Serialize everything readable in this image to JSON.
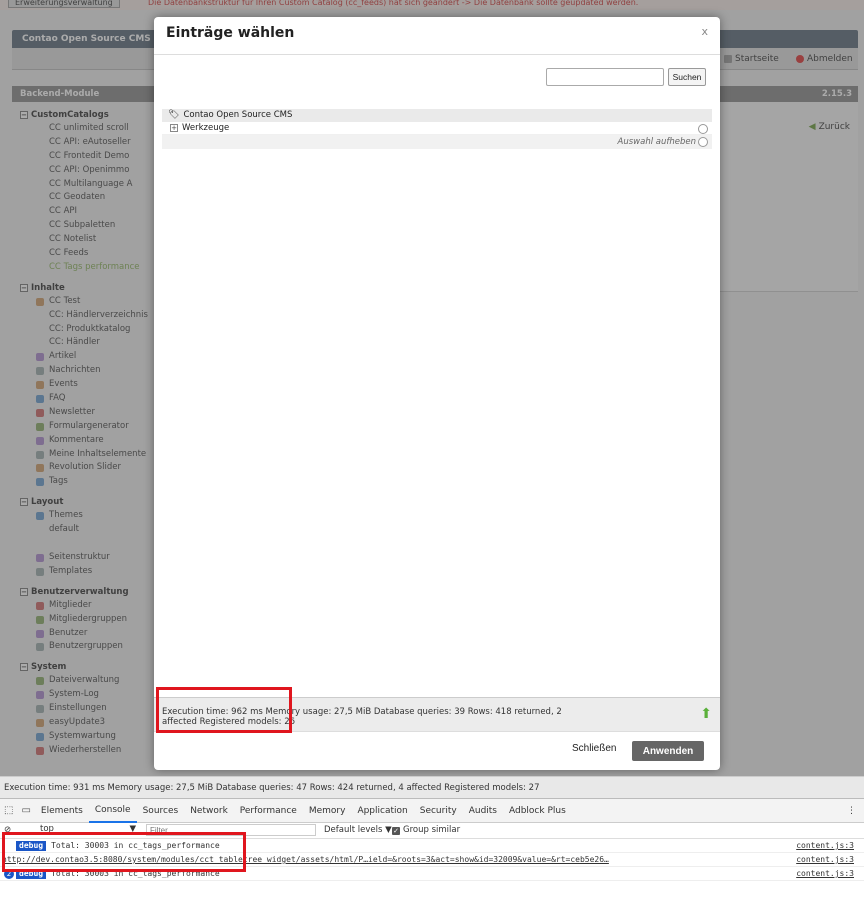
{
  "top_warning": {
    "button": "Erweiterungsverwaltung",
    "text": "Die Datenbankstruktur für Ihren Custom Catalog (cc_feeds) hat sich geändert -> Die Datenbank sollte geupdated werden."
  },
  "cms": {
    "title": "Contao Open Source CMS",
    "startseite": "Startseite",
    "abmelden": "Abmelden",
    "backend_modules": "Backend-Module",
    "version": "2.15.3",
    "zurueck": "Zurück"
  },
  "sidebar": {
    "groups": [
      {
        "label": "CustomCatalogs",
        "items": [
          "CC unlimited scroll",
          "CC API: eAutoseller",
          "CC Frontedit Demo",
          "CC API: Openimmo",
          "CC Multilanguage A",
          "CC Geodaten",
          "CC API",
          "CC Subpaletten",
          "CC Notelist",
          "CC Feeds",
          "CC Tags performance"
        ]
      },
      {
        "label": "Inhalte",
        "items": [
          "CC Test",
          "CC: Händlerverzeichnis",
          "CC: Produktkatalog",
          "CC: Händler",
          "Artikel",
          "Nachrichten",
          "Events",
          "FAQ",
          "Newsletter",
          "Formulargenerator",
          "Kommentare",
          "Meine Inhaltselemente",
          "Revolution Slider",
          "Tags"
        ]
      },
      {
        "label": "Layout",
        "items": [
          "Themes",
          "default",
          "",
          "Seitenstruktur",
          "Templates"
        ]
      },
      {
        "label": "Benutzerverwaltung",
        "items": [
          "Mitglieder",
          "Mitgliedergruppen",
          "Benutzer",
          "Benutzergruppen"
        ]
      },
      {
        "label": "System",
        "items": [
          "Dateiverwaltung",
          "System-Log",
          "Einstellungen",
          "easyUpdate3",
          "Systemwartung",
          "Wiederherstellen"
        ]
      }
    ]
  },
  "modal": {
    "title": "Einträge wählen",
    "close": "x",
    "search_value": "",
    "search_button": "Suchen",
    "tree_root": "Contao Open Source CMS",
    "tree_item": "Werkzeuge",
    "clear_selection": "Auswahl aufheben",
    "debug_line1": "Execution time: 962 ms    Memory usage: 27,5 MiB    Database queries: 39    Rows: 418 returned, 2",
    "debug_line2": "affected    Registered models: 26",
    "close_button": "Schließen",
    "apply_button": "Anwenden"
  },
  "page_debug": {
    "text": "Execution time: 931 ms     Memory usage: 27,5 MiB     Database queries: 47     Rows: 424 returned, 4 affected     Registered models: 27"
  },
  "devtools": {
    "tabs": [
      "Elements",
      "Console",
      "Sources",
      "Network",
      "Performance",
      "Memory",
      "Application",
      "Security",
      "Audits",
      "Adblock Plus"
    ],
    "active_tab": "Console",
    "context": "top",
    "filter_placeholder": "Filter",
    "levels": "Default levels ▼",
    "group_similar": "Group similar",
    "logs": [
      {
        "badge": "debug",
        "text": "Total: 30003 in cc_tags_performance",
        "source": "content.js:3",
        "count": ""
      },
      {
        "badge": "",
        "text": "http://dev.contao3.5:8080/system/modules/cct_tabletree_widget/assets/html/P…ield=&roots=3&act=show&id=32009&value=&rt=ceb5e26…",
        "source": "content.js:3",
        "count": ""
      },
      {
        "badge": "debug",
        "text": "Total: 30003 in cc_tags_performance",
        "source": "content.js:3",
        "count": "2"
      }
    ]
  }
}
